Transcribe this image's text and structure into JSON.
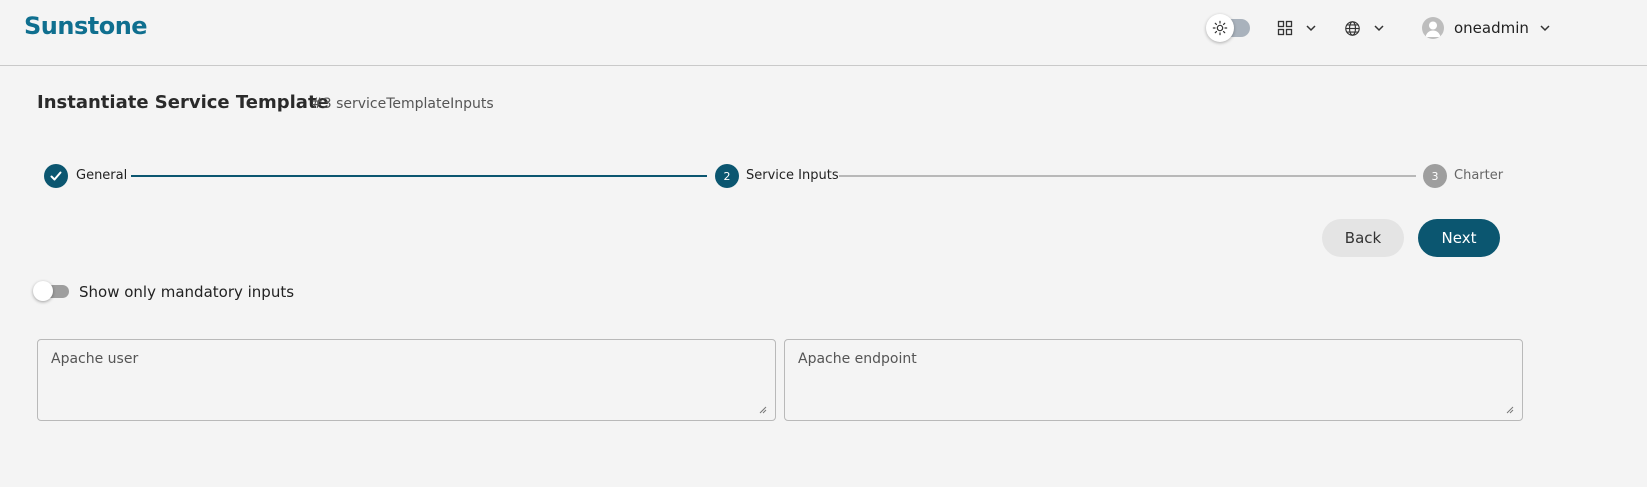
{
  "header": {
    "logo": "Sunstone",
    "username": "oneadmin"
  },
  "page": {
    "title": "Instantiate Service Template",
    "subtitle": "#3 serviceTemplateInputs"
  },
  "stepper": {
    "steps": [
      {
        "number": "1",
        "label": "General",
        "state": "completed"
      },
      {
        "number": "2",
        "label": "Service Inputs",
        "state": "active"
      },
      {
        "number": "3",
        "label": "Charter",
        "state": "pending"
      }
    ]
  },
  "actions": {
    "back_label": "Back",
    "next_label": "Next"
  },
  "filter": {
    "mandatory_label": "Show only mandatory inputs",
    "mandatory_on": false
  },
  "inputs": {
    "apache_user": {
      "label": "Apache user",
      "value": ""
    },
    "apache_endpoint": {
      "label": "Apache endpoint",
      "value": ""
    }
  },
  "colors": {
    "brand": "#0f6f8f",
    "primary": "#0b5670",
    "pending": "#9e9e9e",
    "background": "#f4f4f4"
  },
  "icons": {
    "theme": "sun-icon",
    "apps": "grid-icon",
    "language": "globe-icon",
    "user": "user-avatar-icon",
    "completed_step": "check-icon"
  }
}
